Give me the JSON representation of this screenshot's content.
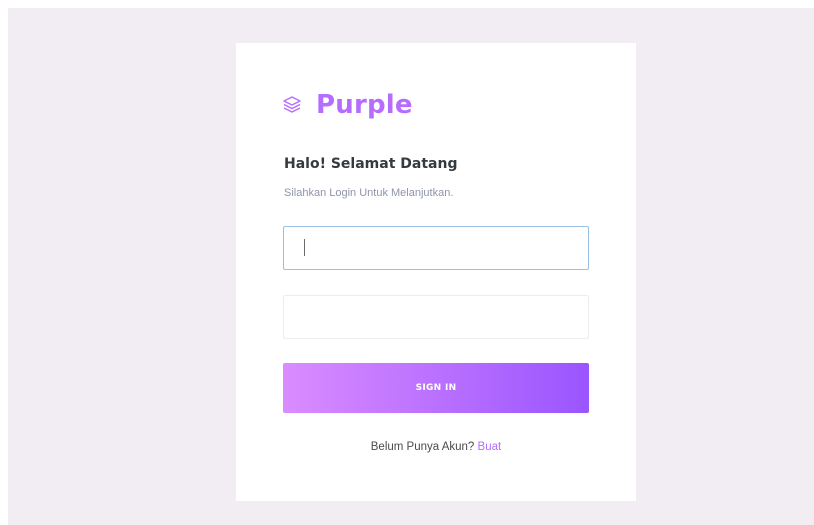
{
  "brand": {
    "name": "Purple",
    "icon": "layers-icon",
    "color": "#b66dff"
  },
  "welcome": {
    "title": "Halo! Selamat Datang",
    "subtitle": "Silahkan Login Untuk Melanjutkan."
  },
  "form": {
    "username": {
      "value": "",
      "placeholder": ""
    },
    "password": {
      "value": "",
      "placeholder": ""
    },
    "submit_label": "SIGN IN"
  },
  "register": {
    "prompt": "Belum Punya Akun?",
    "link_label": "Buat"
  },
  "colors": {
    "background": "#f2edf3",
    "card": "#ffffff",
    "accent": "#b66dff",
    "button_gradient_start": "#da8cff",
    "button_gradient_end": "#9a55ff"
  }
}
